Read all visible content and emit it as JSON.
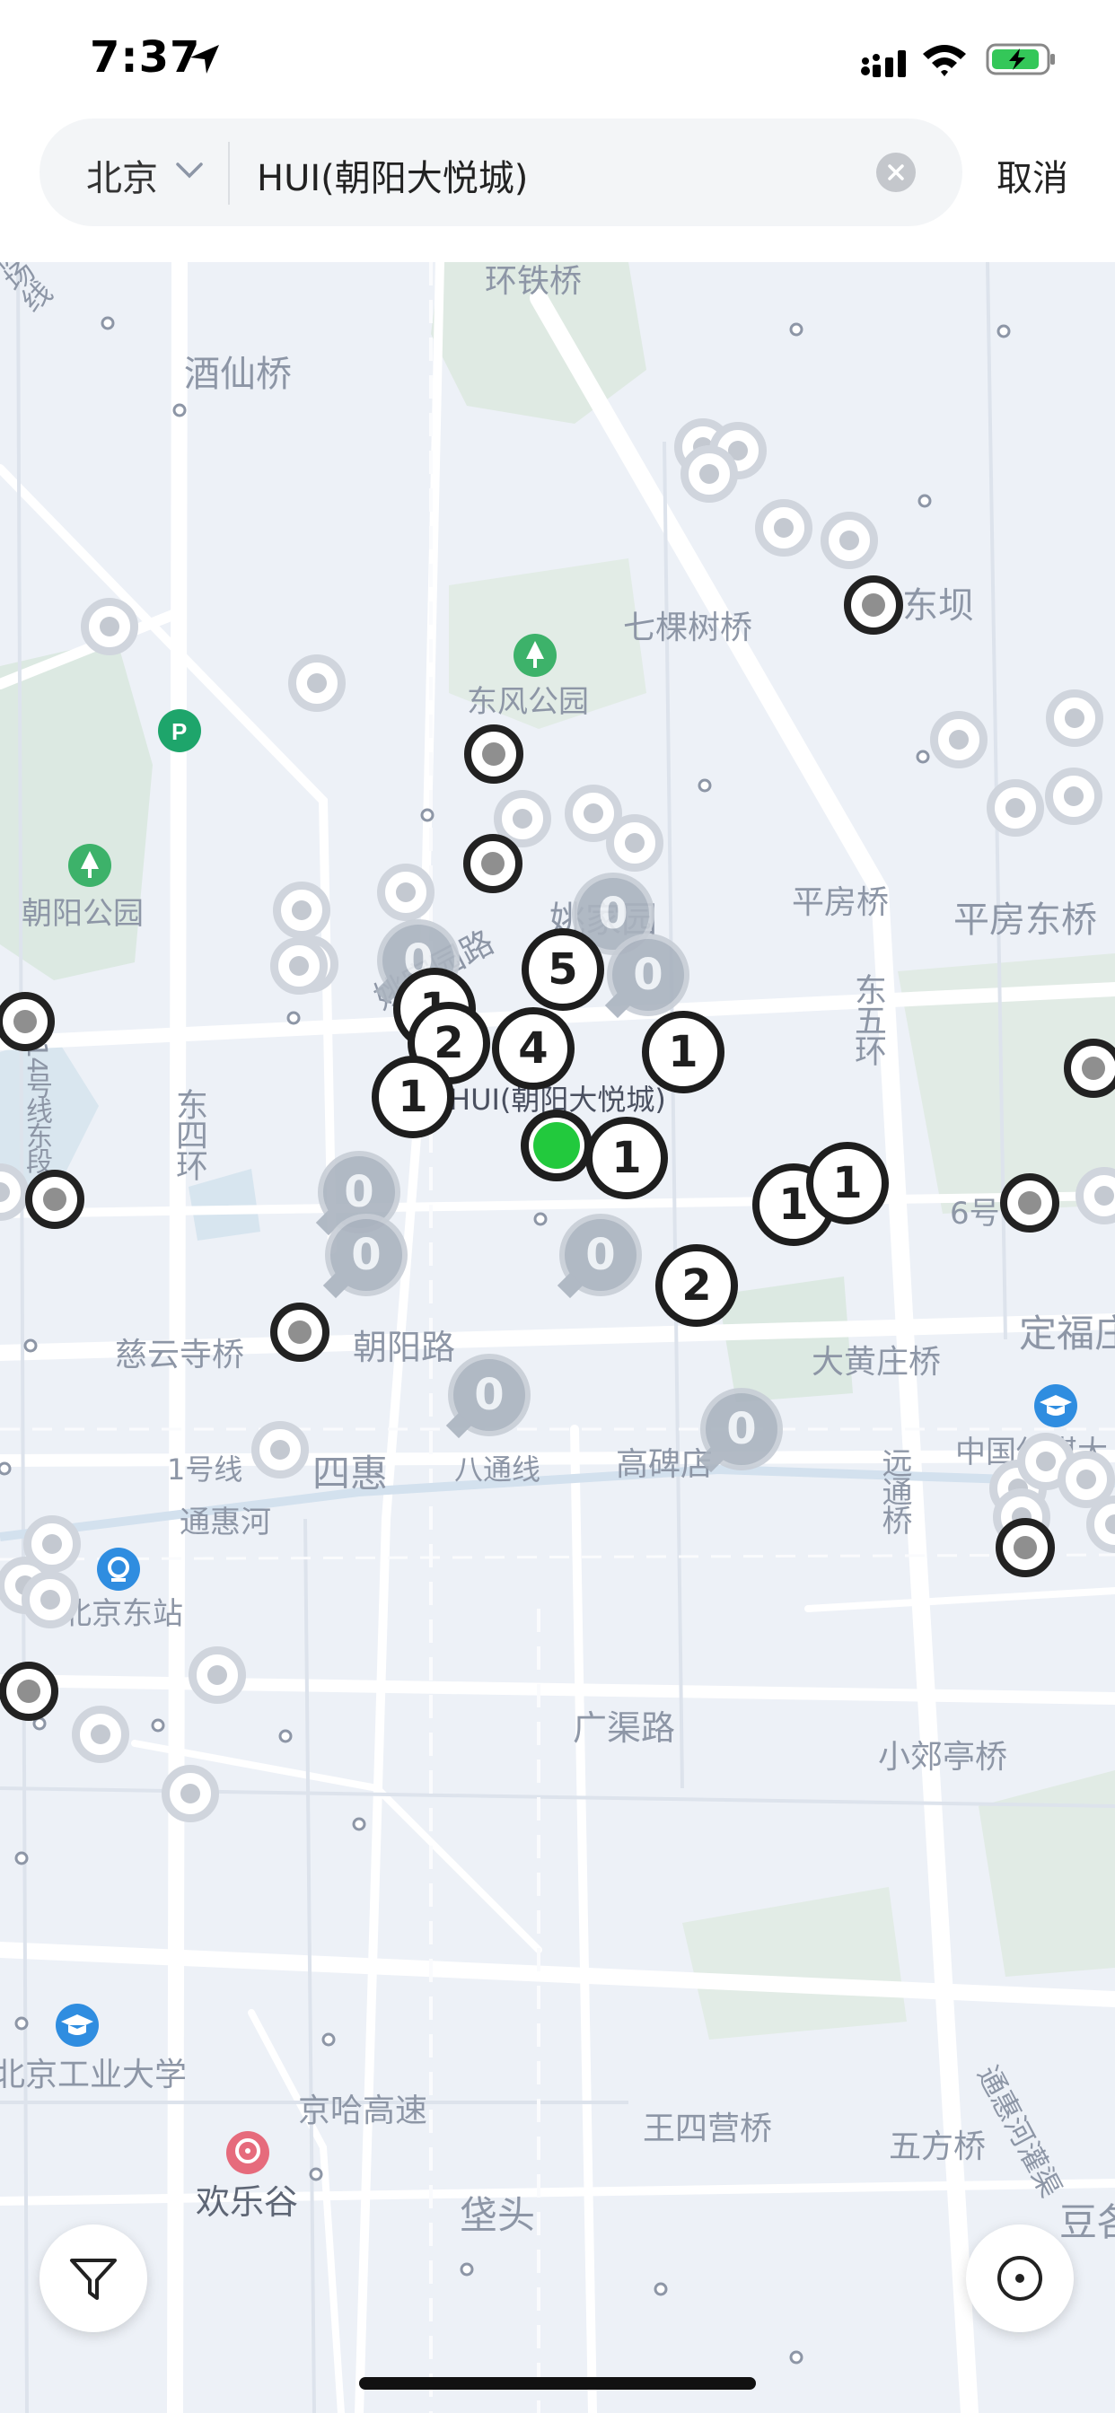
{
  "status_bar": {
    "time": "7:37"
  },
  "search": {
    "city": "北京",
    "query": "HUI(朝阳大悦城)",
    "cancel_label": "取消"
  },
  "map": {
    "labels": {
      "huantie": "环铁桥",
      "jiuxianqiao": "酒仙桥",
      "qikeshuqiao": "七棵树桥",
      "dongba": "东坝",
      "dongfeng_park": "东风公园",
      "chaoyang_park": "朝阳公园",
      "pingfangqiao": "平房桥",
      "pingfangdongqiao": "平房东桥",
      "yaojiayuan": "姚家园",
      "yaojiayuan_road": "姚家园路",
      "dongwuhuan": "东五环",
      "dongsihuan": "东四环",
      "line14": "14号线东段",
      "destination": "HUI(朝阳大悦城)",
      "line6": "6号",
      "ciyunsi": "慈云寺桥",
      "chaoyang_road": "朝阳路",
      "dahuangzhuang": "大黄庄桥",
      "dingfu": "定福庄",
      "line1": "1号线",
      "sihui": "四惠",
      "batong": "八通线",
      "gaobeidian": "高碑店",
      "tonghuihe": "通惠河",
      "yuantongqiao": "远通桥",
      "zhongguo_chuanmei": "中国传媒大",
      "beijing_east": "北京东站",
      "guangqu_road": "广渠路",
      "xiaojiaoting": "小郊亭桥",
      "tonghui_canal": "通惠河灌渠",
      "bjut": "北京工业大学",
      "jingha": "京哈高速",
      "wangsiying": "王四营桥",
      "wufang": "五方桥",
      "happy_valley": "欢乐谷",
      "dougezhuang": "豆各",
      "jiangtou": "垡头",
      "airport_line": "机场线"
    },
    "bubbles": {
      "b1": "0",
      "b2": "0",
      "b3": "5",
      "b4": "1",
      "b5": "0",
      "b6": "2",
      "b7": "4",
      "b8": "1",
      "b9": "1",
      "b10": "1",
      "b11": "0",
      "b12": "0",
      "b13": "1",
      "b14": "1",
      "b15": "0",
      "b16": "2",
      "b17": "0",
      "b18": "0"
    }
  },
  "colors": {
    "accent_green": "#22c93d",
    "marker_dark": "#1e1e1e",
    "map_bg": "#edf1f7"
  },
  "icons": {
    "filter": "filter-icon",
    "locate": "locate-icon",
    "parking": "parking-icon",
    "park": "tree-icon",
    "university": "graduation-cap-icon",
    "station": "train-icon",
    "amusement": "ferris-wheel-icon"
  }
}
